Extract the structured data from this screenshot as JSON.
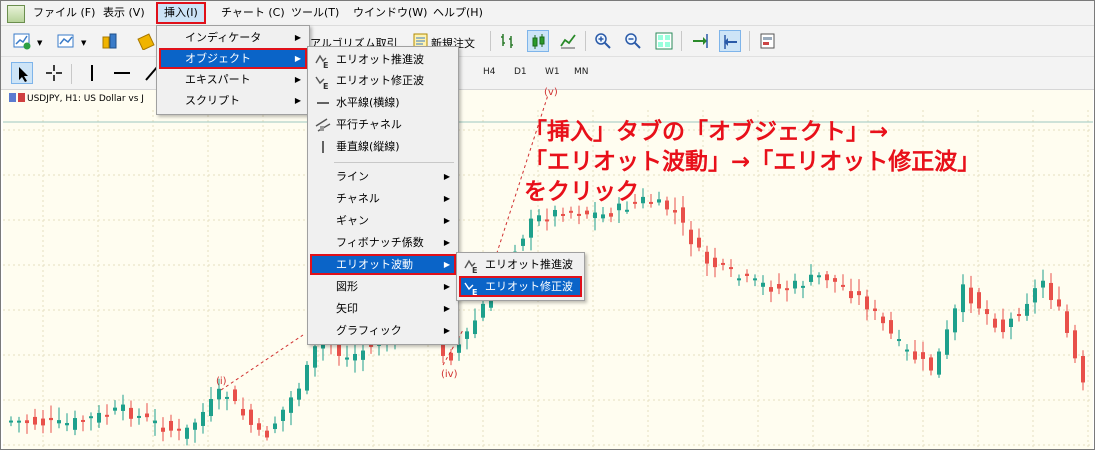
{
  "menubar": {
    "items": [
      {
        "label": "ファイル (F)"
      },
      {
        "label": "表示 (V)"
      },
      {
        "label": "挿入(I)"
      },
      {
        "label": "チャート (C)"
      },
      {
        "label": "ツール(T)"
      },
      {
        "label": "ウインドウ(W)"
      },
      {
        "label": "ヘルプ(H)"
      }
    ]
  },
  "toolbar": {
    "algo_label": "アルゴリズム取引",
    "new_order_label": "新規注文",
    "timeframes": [
      "H4",
      "D1",
      "W1",
      "MN"
    ]
  },
  "chart": {
    "title": "USDJPY, H1:  US Dollar vs J",
    "wave_labels": [
      "(i)",
      "(iv)",
      "(v)"
    ],
    "colors": {
      "bull": "#1ea08c",
      "bear": "#e8504a",
      "background": "#fffdf0"
    }
  },
  "insert_menu": {
    "items": [
      {
        "label": "インディケータ"
      },
      {
        "label": "オブジェクト"
      },
      {
        "label": "エキスパート"
      },
      {
        "label": "スクリプト"
      }
    ]
  },
  "objects_menu": {
    "items": [
      {
        "label": "エリオット推進波",
        "icon": "elliott-impulse-icon"
      },
      {
        "label": "エリオット修正波",
        "icon": "elliott-correction-icon"
      },
      {
        "label": "水平線(横線)",
        "icon": "horizontal-line-icon"
      },
      {
        "label": "平行チャネル",
        "icon": "parallel-channel-icon"
      },
      {
        "label": "垂直線(縦線)",
        "icon": "vertical-line-icon"
      }
    ],
    "submenus": [
      {
        "label": "ライン"
      },
      {
        "label": "チャネル"
      },
      {
        "label": "ギャン"
      },
      {
        "label": "フィボナッチ係数"
      },
      {
        "label": "エリオット波動"
      },
      {
        "label": "図形"
      },
      {
        "label": "矢印"
      },
      {
        "label": "グラフィック"
      }
    ]
  },
  "elliott_menu": {
    "items": [
      {
        "label": "エリオット推進波",
        "icon": "elliott-impulse-icon"
      },
      {
        "label": "エリオット修正波",
        "icon": "elliott-correction-icon"
      }
    ]
  },
  "annotation": {
    "lines": [
      "「挿入」タブの「オブジェクト」→",
      "「エリオット波動」→「エリオット修正波」",
      "をクリック"
    ]
  }
}
